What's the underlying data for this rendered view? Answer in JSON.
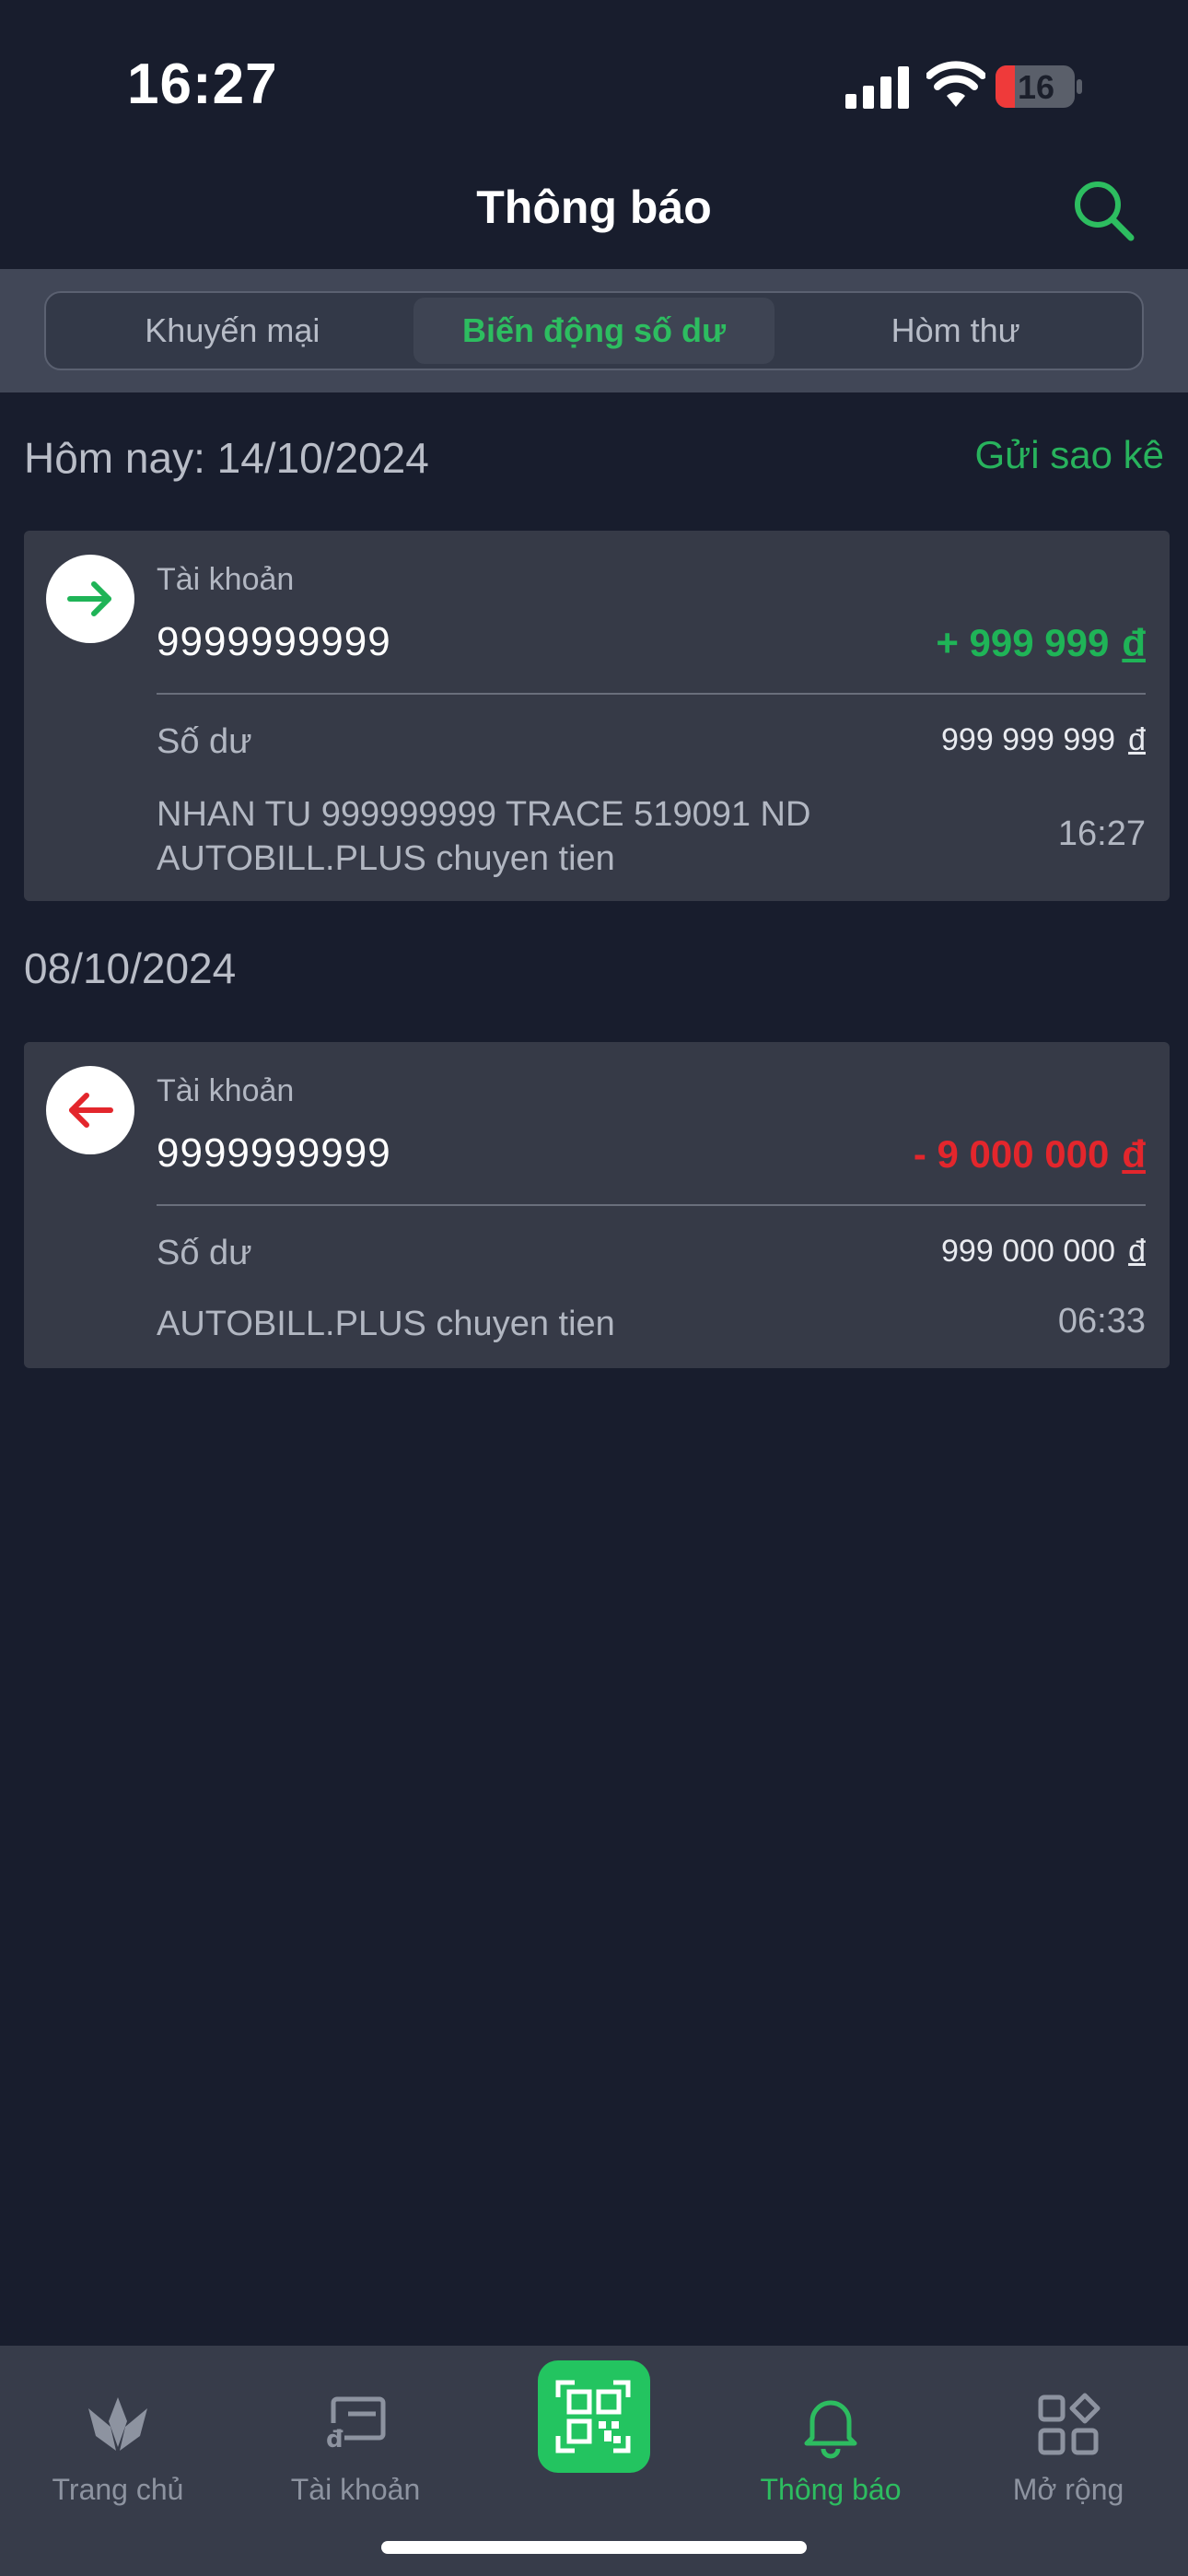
{
  "status_bar": {
    "time": "16:27",
    "battery": "16"
  },
  "header": {
    "title": "Thông báo"
  },
  "tabs": [
    {
      "label": "Khuyến mại",
      "active": false
    },
    {
      "label": "Biến động số dư",
      "active": true
    },
    {
      "label": "Hòm thư",
      "active": false
    }
  ],
  "sections": [
    {
      "date": "Hôm nay: 14/10/2024",
      "action": "Gửi sao kê",
      "transactions": [
        {
          "direction": "in",
          "account_label": "Tài khoản",
          "account_number": "9999999999",
          "amount": "+ 999 999",
          "currency": "đ",
          "balance_label": "Số dư",
          "balance": "999 999 999",
          "description": "NHAN TU 999999999 TRACE 519091 ND AUTOBILL.PLUS chuyen tien",
          "time": "16:27"
        }
      ]
    },
    {
      "date": "08/10/2024",
      "transactions": [
        {
          "direction": "out",
          "account_label": "Tài khoản",
          "account_number": "9999999999",
          "amount": "- 9 000 000",
          "currency": "đ",
          "balance_label": "Số dư",
          "balance": "999 000 000",
          "description": "AUTOBILL.PLUS chuyen tien",
          "time": "06:33"
        }
      ]
    }
  ],
  "bottom_nav": [
    {
      "label": "Trang chủ",
      "icon": "lotus-icon",
      "active": false
    },
    {
      "label": "Tài khoản",
      "icon": "wallet-icon",
      "active": false
    },
    {
      "label": "",
      "icon": "qr-scan-icon",
      "active": false
    },
    {
      "label": "Thông báo",
      "icon": "bell-icon",
      "active": true
    },
    {
      "label": "Mở rộng",
      "icon": "apps-icon",
      "active": false
    }
  ],
  "colors": {
    "accent": "#2dbd60",
    "credit": "#1fb457",
    "debit": "#e3262c",
    "background": "#181d2d",
    "card": "#363a47"
  }
}
